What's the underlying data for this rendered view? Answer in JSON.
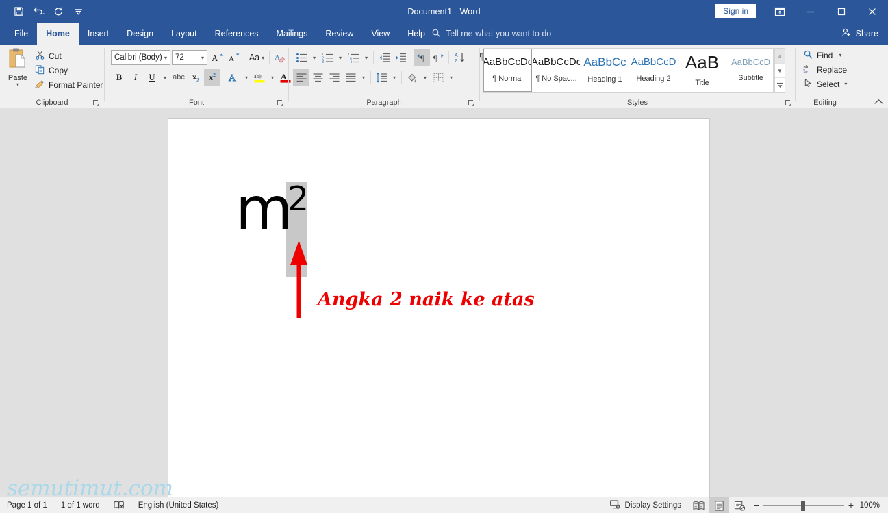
{
  "titlebar": {
    "document_title": "Document1  -  Word",
    "signin_label": "Sign in",
    "qat": [
      {
        "name": "save-icon",
        "tooltip": "Save"
      },
      {
        "name": "undo-icon",
        "tooltip": "Undo"
      },
      {
        "name": "redo-icon",
        "tooltip": "Redo"
      },
      {
        "name": "customize-quick-access-toolbar-icon",
        "tooltip": "Customize Quick Access Toolbar"
      }
    ],
    "window_controls": [
      "ribbon-display-options",
      "minimize",
      "maximize",
      "close"
    ],
    "accent_color": "#2b579a"
  },
  "tabs": [
    {
      "label": "File",
      "active": false
    },
    {
      "label": "Home",
      "active": true
    },
    {
      "label": "Insert",
      "active": false
    },
    {
      "label": "Design",
      "active": false
    },
    {
      "label": "Layout",
      "active": false
    },
    {
      "label": "References",
      "active": false
    },
    {
      "label": "Mailings",
      "active": false
    },
    {
      "label": "Review",
      "active": false
    },
    {
      "label": "View",
      "active": false
    },
    {
      "label": "Help",
      "active": false
    }
  ],
  "tellme": {
    "placeholder": "Tell me what you want to do"
  },
  "share": {
    "label": "Share"
  },
  "ribbon": {
    "clipboard": {
      "label": "Clipboard",
      "paste_label": "Paste",
      "commands": [
        {
          "label": "Cut",
          "icon": "scissors-icon"
        },
        {
          "label": "Copy",
          "icon": "copy-icon"
        },
        {
          "label": "Format Painter",
          "icon": "format-painter-icon"
        }
      ]
    },
    "font": {
      "label": "Font",
      "font_name": "Calibri (Body)",
      "font_size": "72",
      "buttons": [
        {
          "name": "grow-font",
          "glyph": "A"
        },
        {
          "name": "shrink-font",
          "glyph": "A"
        },
        {
          "name": "change-case",
          "glyph": "Aa"
        },
        {
          "name": "clear-formatting",
          "glyph": "A"
        },
        {
          "name": "bold",
          "glyph": "B"
        },
        {
          "name": "italic",
          "glyph": "I"
        },
        {
          "name": "underline",
          "glyph": "U"
        },
        {
          "name": "strikethrough",
          "glyph": "abc"
        },
        {
          "name": "subscript",
          "glyph": "x"
        },
        {
          "name": "superscript",
          "glyph": "x",
          "active": true
        },
        {
          "name": "text-effects",
          "glyph": "A"
        },
        {
          "name": "text-highlight-color",
          "glyph": "ab"
        },
        {
          "name": "font-color",
          "glyph": "A"
        }
      ]
    },
    "paragraph": {
      "label": "Paragraph",
      "row1": [
        "bullets",
        "numbering",
        "multilevel-list",
        "decrease-indent",
        "increase-indent",
        "left-to-right-text-direction",
        "right-to-left-text-direction",
        "sort",
        "show-formatting-marks"
      ],
      "row2": [
        "align-left",
        "center",
        "align-right",
        "justify",
        "line-and-paragraph-spacing",
        "shading",
        "borders"
      ],
      "active": [
        "left-to-right-text-direction",
        "align-left"
      ]
    },
    "styles": {
      "label": "Styles",
      "items": [
        {
          "sample": "AaBbCcDc",
          "name": "¶ Normal",
          "selected": true,
          "color": "#1a1a1a"
        },
        {
          "sample": "AaBbCcDc",
          "name": "¶ No Spac...",
          "selected": false,
          "color": "#1a1a1a"
        },
        {
          "sample": "AaBbCc",
          "name": "Heading 1",
          "selected": false,
          "color": "#2e74b5"
        },
        {
          "sample": "AaBbCcD",
          "name": "Heading 2",
          "selected": false,
          "color": "#2e74b5"
        },
        {
          "sample": "AaB",
          "name": "Title",
          "selected": false,
          "color": "#1a1a1a"
        },
        {
          "sample": "AaBbCcD",
          "name": "Subtitle",
          "selected": false,
          "color": "#6e90ab"
        }
      ]
    },
    "editing": {
      "label": "Editing",
      "commands": [
        {
          "label": "Find",
          "icon": "search-icon",
          "dropdown": true
        },
        {
          "label": "Replace",
          "icon": "replace-icon",
          "dropdown": false
        },
        {
          "label": "Select",
          "icon": "select-cursor-icon",
          "dropdown": true
        }
      ]
    }
  },
  "document": {
    "base_text": "m",
    "superscript_text": "2",
    "annotation": "Angka 2 naik ke atas",
    "annotation_color": "#ee0000",
    "selection_color": "#c8c8c8",
    "watermark": "semutimut.com"
  },
  "statusbar": {
    "page": "Page 1 of 1",
    "words": "1 of 1 word",
    "proofing_icon": "proofing-errors-icon",
    "language": "English (United States)",
    "display_settings": "Display Settings",
    "views": [
      {
        "name": "read-mode",
        "active": false
      },
      {
        "name": "print-layout",
        "active": true
      },
      {
        "name": "web-layout",
        "active": false
      }
    ],
    "zoom_out": "−",
    "zoom_in": "+",
    "zoom_level": "100%"
  }
}
